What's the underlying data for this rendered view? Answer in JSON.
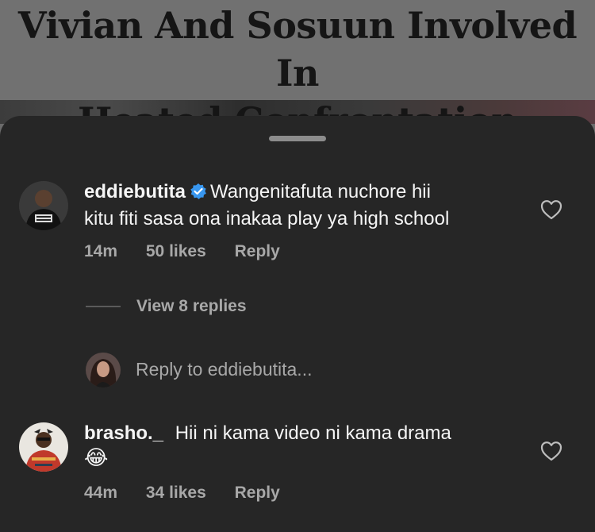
{
  "background": {
    "headline_line1": "Vivian And Sosuun Involved In",
    "headline_line2": "Heated Confrontation"
  },
  "colors": {
    "sheet": "#262626",
    "text": "#f5f5f5",
    "muted": "#a8a8a8",
    "verified": "#3897f0"
  },
  "comments": [
    {
      "username": "eddiebutita",
      "verified": true,
      "text_line1": "Wangenitafuta nuchore hii",
      "text_line2": "kitu fiti sasa ona inakaa play ya high school",
      "time": "14m",
      "likes": "50 likes",
      "reply": "Reply",
      "view_replies": "View 8 replies",
      "icon": "heart-outline-icon"
    },
    {
      "username": "brasho._",
      "verified": false,
      "text_line1": "Hii ni kama video ni kama drama",
      "emoji": "😂",
      "time": "44m",
      "likes": "34 likes",
      "reply": "Reply",
      "icon": "heart-outline-icon"
    }
  ],
  "reply_prompt": "Reply to eddiebutita..."
}
